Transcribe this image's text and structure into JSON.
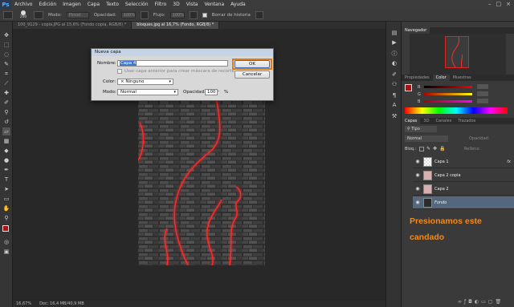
{
  "app": {
    "logo_text": "Ps",
    "menu": [
      "Archivo",
      "Edición",
      "Imagen",
      "Capa",
      "Texto",
      "Selección",
      "Filtro",
      "3D",
      "Vista",
      "Ventana",
      "Ayuda"
    ]
  },
  "options": {
    "brush_size": "200",
    "mode_label": "Modo:",
    "mode_value": "Pincel",
    "opacity_label": "Opacidad:",
    "opacity_value": "100%",
    "flow_label": "Flujo:",
    "flow_value": "100%",
    "erase_history_label": "Borrar de historia"
  },
  "tabs": [
    {
      "label": "100_9129 - copia.JPG al 15,6% (Fondo copia, RGB/8) *",
      "active": false
    },
    {
      "label": "bloques.jpg al 16,7% (Fondo, RGB/8) *",
      "active": true
    }
  ],
  "status": {
    "zoom": "16,67%",
    "doc_size": "Doc: 16,4 MB/40,9 MB"
  },
  "dialog": {
    "title": "Nueva capa",
    "name_label": "Nombre:",
    "name_value": "Capa 4",
    "clip_label": "Usar capa anterior para crear máscara de recorte",
    "color_label": "Color:",
    "color_value": "Ninguno",
    "mode_label": "Modo:",
    "mode_value": "Normal",
    "opacity_label": "Opacidad:",
    "opacity_value": "100",
    "opacity_unit": "%",
    "ok_label": "OK",
    "cancel_label": "Cancelar"
  },
  "panels": {
    "navigator_tab": "Navegador",
    "color_tabs": [
      "Propiedades",
      "Color",
      "Muestras"
    ],
    "layers_tabs": [
      "Capas",
      "3D",
      "Canales",
      "Trazados"
    ],
    "filter_label": "Tipo",
    "blend_mode": "Normal",
    "opacity_label": "Opacidad:",
    "lock_label": "Bloq.:",
    "fill_label": "Relleno:",
    "layers": [
      {
        "name": "Capa 1",
        "selected": false,
        "fx": "fx"
      },
      {
        "name": "Capa 2 copia",
        "selected": false,
        "fx": ""
      },
      {
        "name": "Capa 2",
        "selected": false,
        "fx": ""
      },
      {
        "name": "Fondo",
        "selected": true,
        "fx": ""
      }
    ]
  },
  "annotation": {
    "line1": "Presionamos este",
    "line2": "candado"
  },
  "colors": {
    "accent": "#f28a1d",
    "neon": "#ff2a2a",
    "dialog_highlight": "#e07b1c"
  }
}
